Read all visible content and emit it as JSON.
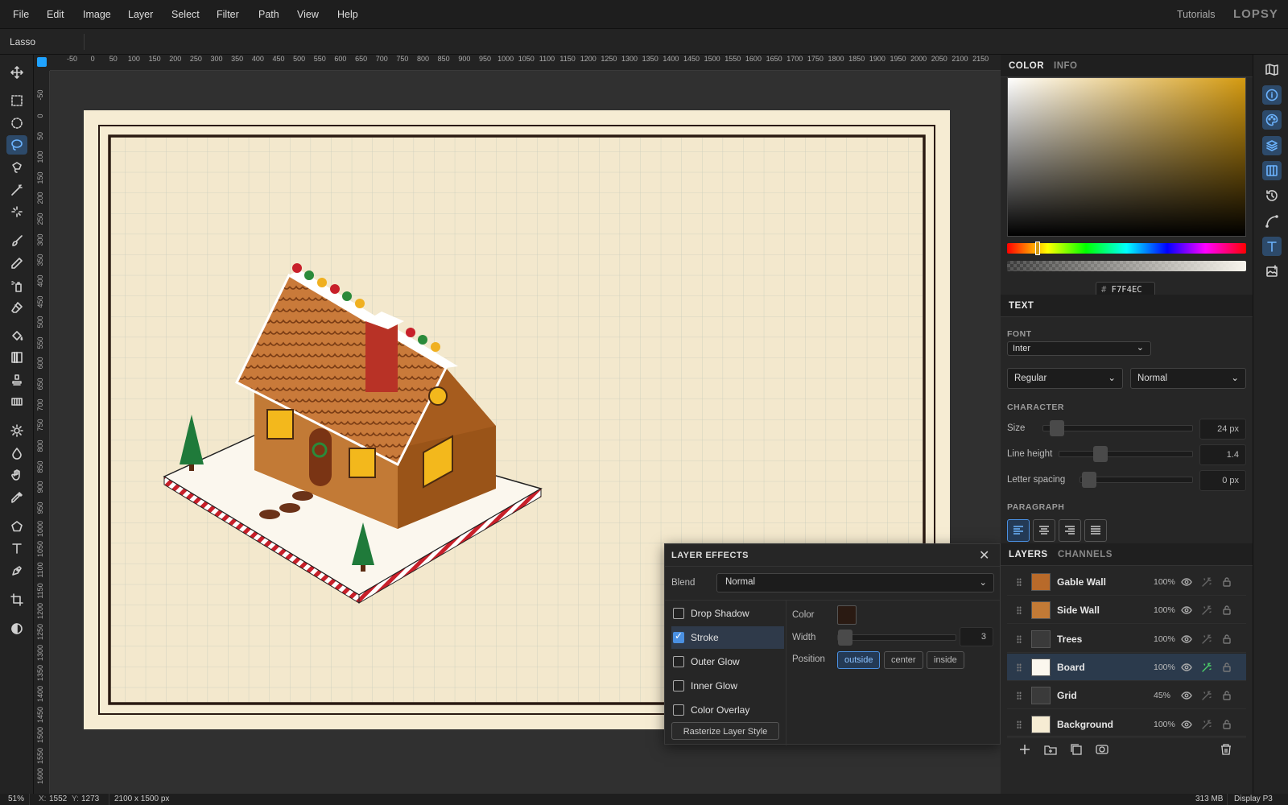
{
  "menu": [
    "File",
    "Edit",
    "Image",
    "Layer",
    "Select",
    "Filter",
    "Path",
    "View",
    "Help"
  ],
  "menu_right": {
    "tutorials": "Tutorials",
    "logo": "LOPSY"
  },
  "options_bar": {
    "tool_name": "Lasso"
  },
  "ruler": {
    "h_labels": [
      "-50",
      "0",
      "50",
      "100",
      "150",
      "200",
      "250",
      "300",
      "350",
      "400",
      "450",
      "500",
      "550",
      "600",
      "650",
      "700",
      "750",
      "800",
      "850",
      "900",
      "950",
      "1000",
      "1050",
      "1100",
      "1150",
      "1200",
      "1250",
      "1300",
      "1350",
      "1400",
      "1450",
      "1500",
      "1550",
      "1600",
      "1650",
      "1700",
      "1750",
      "1800",
      "1850",
      "1900",
      "1950",
      "2000",
      "2050",
      "2100",
      "2150"
    ],
    "v_labels": [
      "-50",
      "0",
      "50",
      "100",
      "150",
      "200",
      "250",
      "300",
      "350",
      "400",
      "450",
      "500",
      "550",
      "600",
      "650",
      "700",
      "750",
      "800",
      "850",
      "900",
      "950",
      "1000",
      "1050",
      "1100",
      "1150",
      "1200",
      "1250",
      "1300",
      "1350",
      "1400",
      "1450",
      "1500",
      "1550",
      "1600"
    ]
  },
  "color_panel": {
    "tabs": [
      "COLOR",
      "INFO"
    ],
    "hex_prefix": "#",
    "hex_value": "F7F4EC",
    "picker_base": "#d49a10"
  },
  "text_panel": {
    "tab": "TEXT",
    "font_section": "FONT",
    "font_family": "Inter",
    "font_weight": "Regular",
    "font_style": "Normal",
    "character_section": "CHARACTER",
    "size_label": "Size",
    "size_value": "24 px",
    "line_height_label": "Line height",
    "line_height_value": "1.4",
    "letter_spacing_label": "Letter spacing",
    "letter_spacing_value": "0 px",
    "paragraph_section": "PARAGRAPH"
  },
  "layers_panel": {
    "tabs": [
      "LAYERS",
      "CHANNELS"
    ],
    "layers": [
      {
        "name": "Gable Wall",
        "opacity": "100%"
      },
      {
        "name": "Side Wall",
        "opacity": "100%"
      },
      {
        "name": "Trees",
        "opacity": "100%"
      },
      {
        "name": "Board",
        "opacity": "100%",
        "selected": true,
        "fx": true
      },
      {
        "name": "Grid",
        "opacity": "45%"
      },
      {
        "name": "Background",
        "opacity": "100%"
      }
    ]
  },
  "layer_effects": {
    "title": "LAYER EFFECTS",
    "blend_label": "Blend",
    "blend_value": "Normal",
    "effects": [
      {
        "name": "Drop Shadow",
        "checked": false
      },
      {
        "name": "Stroke",
        "checked": true
      },
      {
        "name": "Outer Glow",
        "checked": false
      },
      {
        "name": "Inner Glow",
        "checked": false
      },
      {
        "name": "Color Overlay",
        "checked": false
      }
    ],
    "rasterize": "Rasterize Layer Style",
    "color_label": "Color",
    "stroke_color": "#2a1a12",
    "width_label": "Width",
    "width_value": "3",
    "position_label": "Position",
    "positions": [
      "outside",
      "center",
      "inside"
    ],
    "position_selected": "outside"
  },
  "status": {
    "zoom": "51%",
    "x_label": "X:",
    "x": "1552",
    "y_label": "Y:",
    "y": "1273",
    "doc_size": "2100 x 1500 px",
    "memory": "313 MB",
    "display": "Display P3"
  }
}
